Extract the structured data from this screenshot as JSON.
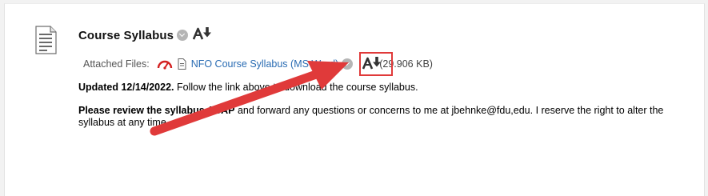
{
  "item": {
    "title": "Course Syllabus",
    "attached_label": "Attached Files:",
    "file_name": "NFO Course Syllabus (MS Word)",
    "file_size": "(29.906 KB)",
    "updated_bold": "Updated 12/14/2022.",
    "updated_rest": "  Follow the link above to download the course syllabus.",
    "review_bold": "Please review the syllabus ASAP",
    "review_rest": " and forward any questions or concerns to me at jbehnke@fdu,edu.  I reserve the right to alter the syllabus at any time."
  },
  "icons": {
    "document": "document-icon",
    "options": "chevron-down-icon",
    "download": "alternate-download-icon",
    "gauge": "speedometer-icon",
    "file": "file-icon"
  },
  "colors": {
    "link": "#2a6cb3",
    "annotation_red": "#e03a3a"
  }
}
